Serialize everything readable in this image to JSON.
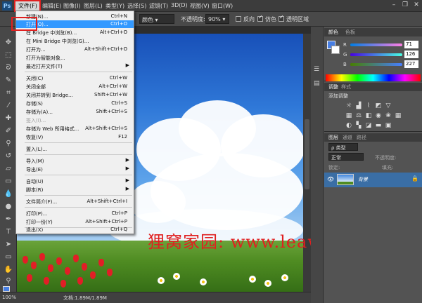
{
  "menubar": {
    "items": [
      "文件(F)",
      "编辑(E)",
      "图像(I)",
      "图层(L)",
      "类型(Y)",
      "选择(S)",
      "滤镜(T)",
      "3D(D)",
      "视图(V)",
      "窗口(W)"
    ]
  },
  "options": {
    "mode_value": "颜色",
    "opacity_label": "不透明度:",
    "opacity_value": "90%",
    "reverse_label": "反向",
    "dither_label": "仿色",
    "transparency_label": "透明区域"
  },
  "file_menu": {
    "items": [
      {
        "label": "新建(N)...",
        "shortcut": "Ctrl+N"
      },
      {
        "label": "打开(O)...",
        "shortcut": "Ctrl+O"
      },
      {
        "label": "在 Bridge 中浏览(B)...",
        "shortcut": "Alt+Ctrl+O"
      },
      {
        "label": "在 Mini Bridge 中浏览(G)...",
        "shortcut": ""
      },
      {
        "label": "打开为...",
        "shortcut": "Alt+Shift+Ctrl+O"
      },
      {
        "label": "打开为智能对象...",
        "shortcut": ""
      },
      {
        "label": "最近打开文件(T)",
        "shortcut": ""
      },
      {
        "label": "关闭(C)",
        "shortcut": "Ctrl+W"
      },
      {
        "label": "关闭全部",
        "shortcut": "Alt+Ctrl+W"
      },
      {
        "label": "关闭并转到 Bridge...",
        "shortcut": "Shift+Ctrl+W"
      },
      {
        "label": "存储(S)",
        "shortcut": "Ctrl+S"
      },
      {
        "label": "存储为(A)...",
        "shortcut": "Shift+Ctrl+S"
      },
      {
        "label": "签入(I)...",
        "shortcut": ""
      },
      {
        "label": "存储为 Web 所用格式...",
        "shortcut": "Alt+Shift+Ctrl+S"
      },
      {
        "label": "恢复(V)",
        "shortcut": "F12"
      },
      {
        "label": "置入(L)...",
        "shortcut": ""
      },
      {
        "label": "导入(M)",
        "shortcut": ""
      },
      {
        "label": "导出(E)",
        "shortcut": ""
      },
      {
        "label": "自动(U)",
        "shortcut": ""
      },
      {
        "label": "脚本(R)",
        "shortcut": ""
      },
      {
        "label": "文件简介(F)...",
        "shortcut": "Alt+Shift+Ctrl+I"
      },
      {
        "label": "打印(P)...",
        "shortcut": "Ctrl+P"
      },
      {
        "label": "打印一份(Y)",
        "shortcut": "Alt+Shift+Ctrl+P"
      },
      {
        "label": "退出(X)",
        "shortcut": "Ctrl+Q"
      }
    ]
  },
  "color_panel": {
    "tab_color": "颜色",
    "tab_swatches": "色板",
    "r_label": "R",
    "g_label": "G",
    "b_label": "B",
    "r_value": "71",
    "g_value": "126",
    "b_value": "227"
  },
  "adjust_panel": {
    "tab_adjust": "调整",
    "tab_styles": "样式",
    "title": "添加调整"
  },
  "layers_panel": {
    "tab_layers": "图层",
    "tab_channels": "通道",
    "tab_paths": "路径",
    "kind": "ρ 类型",
    "blend_mode": "正常",
    "opacity_label": "不透明度:",
    "lock_label": "锁定:",
    "fill_label": "填充:",
    "layer_name": "背景"
  },
  "status": {
    "zoom": "100%",
    "doc_info": "文档:1.89M/1.89M"
  },
  "watermark": "狸窝家园: www.leawo.cn",
  "colors": {
    "foreground": "#477ee3",
    "highlight": "#3399ff",
    "annotation": "#e02020"
  }
}
